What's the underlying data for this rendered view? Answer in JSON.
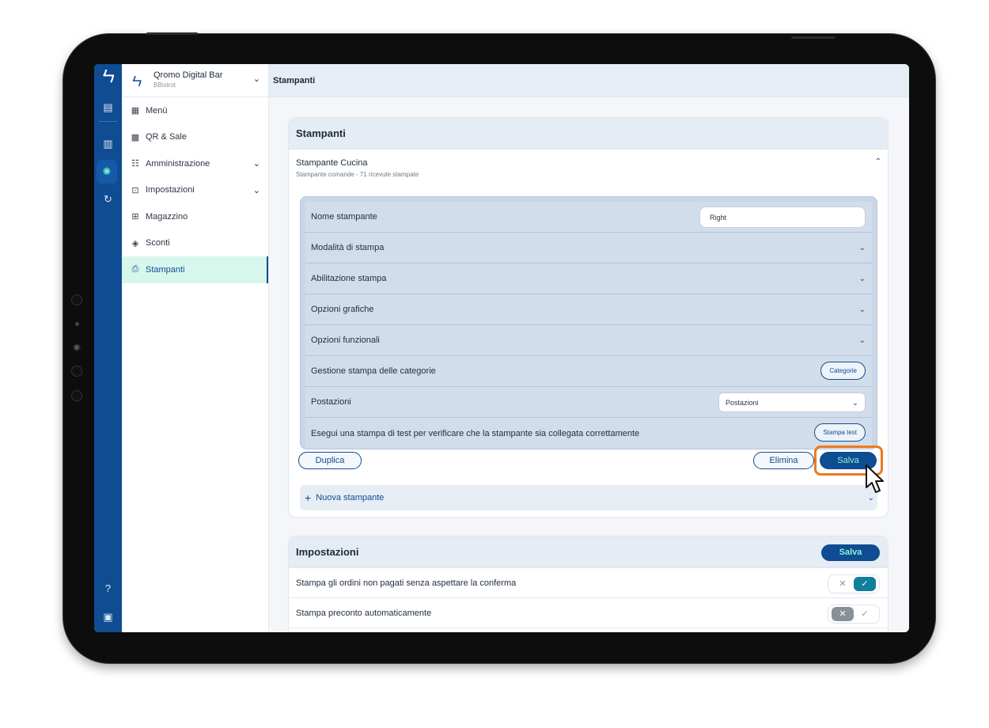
{
  "app": {
    "brand": "Qromo Digital Bar",
    "venue": "BBistrot",
    "page_title": "Stampanti"
  },
  "rail": {
    "icons": [
      "logo-icon",
      "menu-book-icon",
      "stats-icon",
      "settings-icon",
      "orders-icon",
      "help-icon",
      "monitor-icon"
    ]
  },
  "sidebar": {
    "items": [
      {
        "label": "Menù",
        "icon": "menu-icon"
      },
      {
        "label": "QR & Sale",
        "icon": "qr-icon"
      },
      {
        "label": "Amministrazione",
        "icon": "admin-icon"
      },
      {
        "label": "Impostazioni",
        "icon": "settings-icon"
      },
      {
        "label": "Magazzino",
        "icon": "warehouse-icon"
      },
      {
        "label": "Sconti",
        "icon": "discount-icon"
      },
      {
        "label": "Stampanti",
        "icon": "printer-icon"
      }
    ],
    "active": "Stampanti"
  },
  "printers_card": {
    "title": "Stampanti",
    "printer_name": "Stampante Cucina",
    "printer_meta": "Stampante comande - 71 ricevute stampate",
    "rows": {
      "name_label": "Nome stampante",
      "name_value": "Right",
      "print_mode": "Modalità di stampa",
      "print_enable": "Abilitazione stampa",
      "graphic_options": "Opzioni grafiche",
      "functional_options": "Opzioni funzionali",
      "category_management": "Gestione stampa delle categorie",
      "category_button": "Categorie",
      "stations_label": "Postazioni",
      "stations_value": "Postazioni",
      "test_label": "Esegui una stampa di test per verificare che la stampante sia collegata correttamente",
      "test_button": "Stampa test"
    },
    "actions": {
      "duplicate": "Duplica",
      "delete": "Elimina",
      "save": "Salva"
    },
    "new_printer": "Nuova stampante"
  },
  "settings_card": {
    "title": "Impostazioni",
    "save": "Salva",
    "rows": [
      {
        "label": "Stampa gli ordini non pagati senza aspettare la conferma",
        "enabled": true
      },
      {
        "label": "Stampa preconto automaticamente",
        "enabled": false
      }
    ]
  },
  "colors": {
    "primary": "#0f4c92",
    "accent": "#8af2d6",
    "highlight": "#ea7a1e",
    "active_bg": "#d8f7ec"
  }
}
